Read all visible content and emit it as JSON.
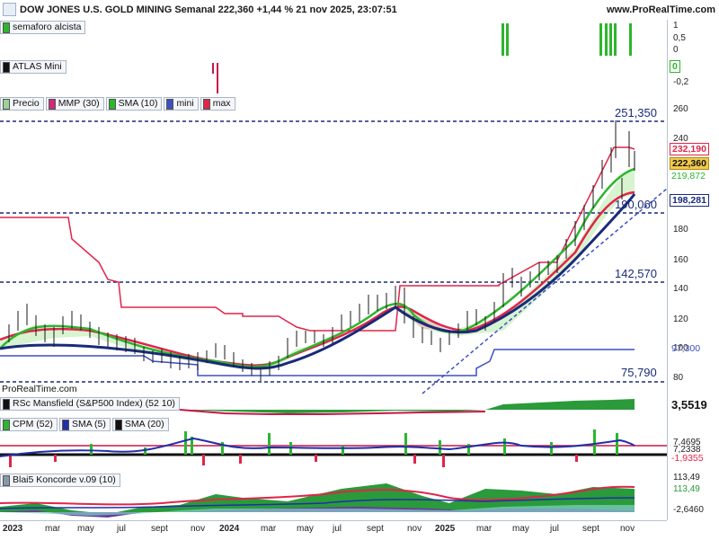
{
  "header": {
    "title": "DOW JONES U.S. GOLD MINING Semanal 222,360 +1,44 % 21 nov 2025, 23:07:51",
    "site": "www.ProRealTime.com"
  },
  "panels": {
    "semaforo": {
      "label": "semaforo alcista",
      "ticks": [
        "1",
        "0,5",
        "0"
      ]
    },
    "atlas": {
      "label": "ATLAS Mini",
      "ticks": [
        "-0,2"
      ],
      "box": "0"
    },
    "price": {
      "legend": [
        {
          "label": "Precio",
          "color": "#9ad29a"
        },
        {
          "label": "MMP (30)",
          "color": "#3b3bc8"
        },
        {
          "label": "SMA (10)",
          "color": "#2db52d"
        },
        {
          "label": "mini",
          "color": "#3d4fc2"
        },
        {
          "label": "max",
          "color": "#e0254a"
        }
      ],
      "ticks": [
        "260",
        "240",
        "200",
        "180",
        "160",
        "140",
        "120",
        "100",
        "80"
      ],
      "level_labels": [
        "251,350",
        "190,060",
        "142,570",
        "75,790"
      ],
      "boxes": [
        {
          "value": "232,190",
          "color": "#e0254a"
        },
        {
          "value": "222,360",
          "color": "#111111",
          "bg": "#f2c94c"
        },
        {
          "value": "219,872",
          "color": "#2db52d"
        },
        {
          "value": "198,281",
          "color": "#1a2a7a"
        },
        {
          "value": "97,300",
          "color": "#3d4fc2"
        }
      ],
      "source": "ProRealTime.com"
    },
    "rsc": {
      "label": "RSc Mansfield (S&P500 Index) (52 10)",
      "value": "3,5519"
    },
    "cpm": {
      "legend": [
        {
          "label": "CPM (52)",
          "color": "#2db52d"
        },
        {
          "label": "SMA (5)",
          "color": "#1f2fa8"
        },
        {
          "label": "SMA (20)",
          "color": "#111111"
        }
      ],
      "values": [
        "7,4695",
        "7,2338",
        "-1,9355"
      ]
    },
    "blai": {
      "label": "Blai5 Koncorde v.09 (10)",
      "values": [
        "113,49",
        "-2,6460"
      ]
    }
  },
  "x_axis": [
    "2023",
    "mar",
    "may",
    "jul",
    "sept",
    "nov",
    "2024",
    "mar",
    "may",
    "jul",
    "sept",
    "nov",
    "2025",
    "mar",
    "may",
    "jul",
    "sept",
    "nov"
  ]
}
